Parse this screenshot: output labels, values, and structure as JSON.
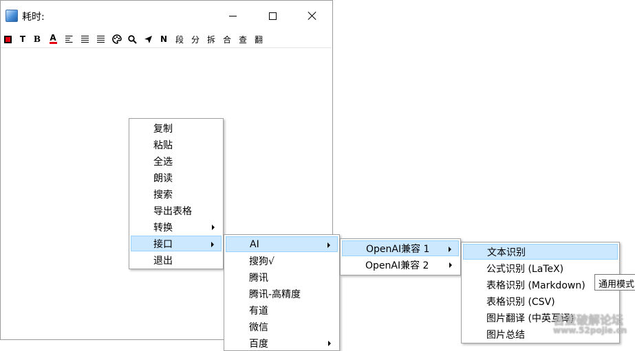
{
  "window": {
    "title": "耗时:",
    "controls": {
      "minimize_icon": "minimize-icon",
      "maximize_icon": "maximize-icon",
      "close_icon": "close-icon"
    }
  },
  "toolbar": {
    "items": [
      {
        "name": "stop-icon",
        "label": ""
      },
      {
        "name": "text-icon",
        "label": "T"
      },
      {
        "name": "bold-icon",
        "label": "B"
      },
      {
        "name": "font-color-icon",
        "label": "A"
      },
      {
        "name": "align-left-icon",
        "label": ""
      },
      {
        "name": "align-justify-icon",
        "label": ""
      },
      {
        "name": "align-right-icon",
        "label": ""
      },
      {
        "name": "palette-icon",
        "label": ""
      },
      {
        "name": "search-icon",
        "label": ""
      },
      {
        "name": "send-icon",
        "label": ""
      },
      {
        "name": "n-icon",
        "label": "N"
      },
      {
        "name": "paragraph-button",
        "label": "段"
      },
      {
        "name": "split-button",
        "label": "分"
      },
      {
        "name": "break-button",
        "label": "拆"
      },
      {
        "name": "merge-button",
        "label": "合"
      },
      {
        "name": "lookup-button",
        "label": "查"
      },
      {
        "name": "translate-button",
        "label": "翻"
      }
    ],
    "accent_red": "#e60012"
  },
  "context_menu": {
    "items": [
      {
        "label": "复制"
      },
      {
        "label": "粘贴"
      },
      {
        "label": "全选"
      },
      {
        "label": "朗读"
      },
      {
        "label": "搜索"
      },
      {
        "label": "导出表格"
      },
      {
        "label": "转换",
        "submenu": true
      },
      {
        "label": "接口",
        "submenu": true,
        "highlighted": true
      },
      {
        "label": "退出"
      }
    ]
  },
  "interface_menu": {
    "items": [
      {
        "label": "AI",
        "submenu": true,
        "highlighted": true
      },
      {
        "label": "搜狗√"
      },
      {
        "label": "腾讯"
      },
      {
        "label": "腾讯-高精度"
      },
      {
        "label": "有道"
      },
      {
        "label": "微信"
      },
      {
        "label": "百度",
        "submenu": true
      }
    ]
  },
  "ai_menu": {
    "items": [
      {
        "label": "OpenAI兼容 1",
        "submenu": true,
        "highlighted": true
      },
      {
        "label": "OpenAI兼容 2",
        "submenu": true
      }
    ]
  },
  "openai_menu": {
    "items": [
      {
        "label": "文本识别",
        "highlighted": true
      },
      {
        "label": "公式识别 (LaTeX)"
      },
      {
        "label": "表格识别 (Markdown)"
      },
      {
        "label": "表格识别 (CSV)"
      },
      {
        "label": "图片翻译 (中英互译)"
      },
      {
        "label": "图片总结"
      }
    ]
  },
  "tooltip": {
    "text": "通用模式"
  },
  "watermark": {
    "title": "吾爱破解论坛",
    "url": "www.52pojie.cn"
  },
  "highlight_color": "#cce8ff"
}
